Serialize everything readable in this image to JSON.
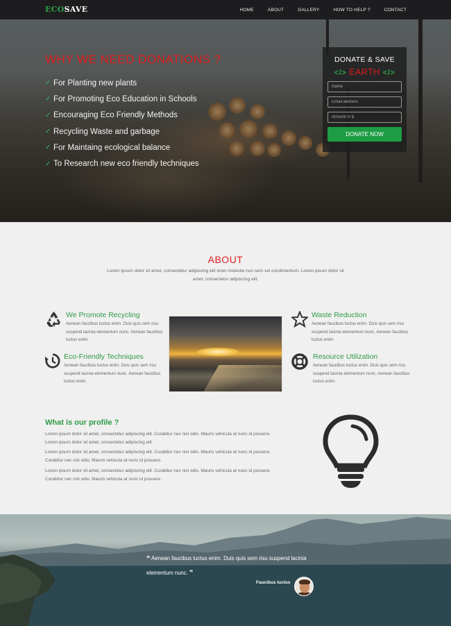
{
  "nav": {
    "logo_eco": "ECO",
    "logo_save": "SAVE",
    "links": [
      "HOME",
      "ABOUT",
      "GALLERY",
      "HOW TO HELP ?",
      "CONTACT"
    ]
  },
  "hero": {
    "title": "WHY WE NEED DONATIONS ?",
    "reasons": [
      "For Planting new plants",
      "For Promoting Eco Education in Schools",
      "Encouraging Eco Friendly Methods",
      "Recycling Waste and garbage",
      "For Maintaing ecological balance",
      "To Research new eco friendly techniques"
    ]
  },
  "donate": {
    "heading": "DONATE & SAVE",
    "code_open": "</>",
    "earth": "EARTH",
    "code_close": "</>",
    "name_placeholder": "Name",
    "email_placeholder": "Email address",
    "amount_placeholder": "Amount in $",
    "button": "DONATE NOW"
  },
  "about": {
    "title": "ABOUT",
    "text": "Lorem ipsum dolor sit amet, consectetur adipiscing elit onec molestie non sem vel condimentum. Lorem ipsum dolor sit amet, consectetur adipiscing elit.",
    "features": {
      "recycling": {
        "title": "We Promote Recycling",
        "text": "Aenean faucibus luctus enim. Duis quis sem risu suspend lacinia elementum nunc. Aenean faucibus luctus enim."
      },
      "eco": {
        "title": "Eco-Friendly Techniques",
        "text": "Aenean faucibus luctus enim. Duis quis sem risu suspend lacinia elementum nunc. Aenean faucibus luctus enim."
      },
      "waste": {
        "title": "Waste Reduction",
        "text": "Aenean faucibus luctus enim. Duis quis sem risu suspend lacinia elementum nunc. Aenean faucibus luctus enim."
      },
      "resource": {
        "title": "Resource Utilization",
        "text": "Aenean faucibus luctus enim. Duis quis sem risu suspend lacinia elementum nunc. Aenean faucibus luctus enim."
      }
    }
  },
  "profile": {
    "title": "What is our profile ?",
    "paragraphs": [
      "Lorem ipsum dolor sit amet, consectetur adipiscing elit. Curabitur nec nisl odio. Mauris vehicula at nunc id posuere. Lorem ipsum dolor sit amet, consectetur adipiscing elit.",
      "Lorem ipsum dolor sit amet, consectetur adipiscing elit. Curabitur nec nisl odio. Mauris vehicula at nunc id posuere. Curabitur nec nisl odio. Mauris vehicula at nunc id posuere.",
      "Lorem ipsum dolor sit amet, consectetur adipiscing elit. Curabitur nec nisl odio. Mauris vehicula at nunc id posuere. Curabitur nec nisl odio. Mauris vehicula at nunc id posuere."
    ]
  },
  "testimonial": {
    "open_quote": "❝",
    "quote": "Aenean faucibus luctus enim. Duis quis sem risu suspend lacinia elementum nunc.",
    "close_quote": "❞",
    "author": "Faucibus luctus"
  },
  "colors": {
    "accent_red": "#e01b1b",
    "accent_green": "#2f9a46",
    "nav_bg": "#1d1d1f",
    "button_green": "#1e9c44"
  }
}
